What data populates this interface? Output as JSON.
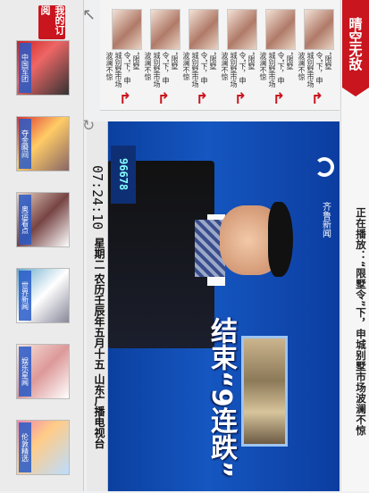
{
  "header": {
    "brand_label": "晴空无敌",
    "now_playing": "正在播放：“限墅令”下，申城别墅市场波澜不惊"
  },
  "thumbnails": [
    {
      "caption": "“限墅令”下，申城别墅市场波澜不惊"
    },
    {
      "caption": "“限墅令”下，申城别墅市场波澜不惊"
    },
    {
      "caption": "“限墅令”下，申城别墅市场波澜不惊"
    },
    {
      "caption": "“限墅令”下，申城别墅市场波澜不惊"
    },
    {
      "caption": "“限墅令”下，申城别墅市场波澜不惊"
    },
    {
      "caption": "“限墅令”下，申城别墅市场波澜不惊"
    }
  ],
  "video": {
    "time": "07:24:10",
    "channel_num": "96678",
    "channel_logo": "齐鲁新闻",
    "caption_line1": "结束“9连跌”",
    "ticker": "星期二  农历壬辰年五月十五  山东广播电视台"
  },
  "leftnav": {
    "my_sub": "我的订阅",
    "categories": [
      "中国军团",
      "夺金瞬间",
      "奥运看点",
      "世界新闻",
      "娱乐星闻",
      "伦敦精选"
    ]
  },
  "icons": {
    "expand": "arrow-diagonal-icon",
    "refresh": "refresh-icon",
    "play": "play-icon"
  },
  "colors": {
    "accent": "#c8151e",
    "video_bg": "#1556c0"
  }
}
